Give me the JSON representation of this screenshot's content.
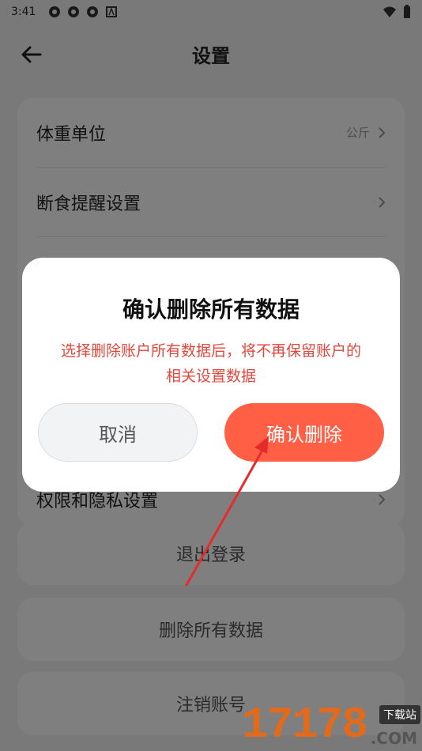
{
  "status_bar": {
    "time": "3:41"
  },
  "header": {
    "title": "设置"
  },
  "settings": {
    "items": [
      {
        "label": "体重单位",
        "value": "公斤"
      },
      {
        "label": "断食提醒设置",
        "value": ""
      },
      {
        "label": "权限和隐私设置",
        "value": ""
      }
    ]
  },
  "actions": {
    "logout": "退出登录",
    "delete_all": "删除所有数据",
    "deregister": "注销账号"
  },
  "dialog": {
    "title": "确认删除所有数据",
    "message": "选择删除账户所有数据后，将不再保留账户的相关设置数据",
    "cancel_label": "取消",
    "confirm_label": "确认删除"
  },
  "colors": {
    "accent": "#fe5f45",
    "warning_text": "#e2473c"
  },
  "watermark": {
    "digits": "17178",
    "tag": "下载站",
    "suffix": ".COM"
  }
}
